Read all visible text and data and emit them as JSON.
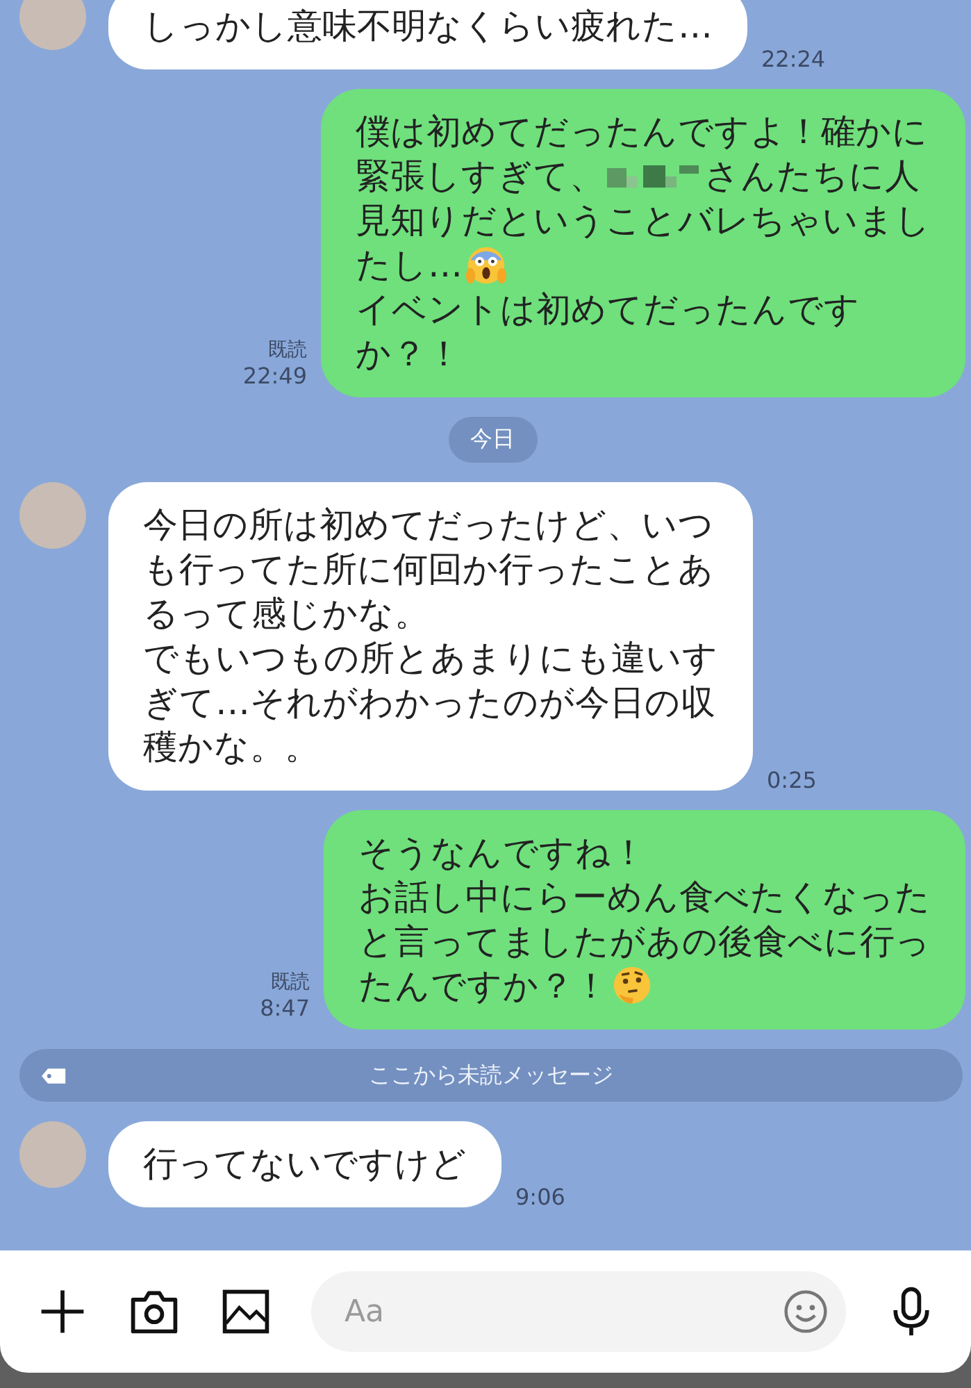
{
  "messages": [
    {
      "kind": "received",
      "lines": [
        [
          {
            "kind": "text",
            "text": "しっかし意味不明なくらい疲れた…"
          }
        ]
      ],
      "time": "22:24"
    },
    {
      "kind": "sent",
      "lines": [
        [
          {
            "kind": "text",
            "text": "僕は初めてだったんですよ！確かに"
          }
        ],
        [
          {
            "kind": "text",
            "text": "緊張しすぎて、"
          },
          {
            "kind": "redacted"
          },
          {
            "kind": "text",
            "text": "さんたちに人"
          }
        ],
        [
          {
            "kind": "text",
            "text": "見知りだということバレちゃいまし"
          }
        ],
        [
          {
            "kind": "text",
            "text": "たし…"
          },
          {
            "kind": "scream"
          }
        ],
        [
          {
            "kind": "text",
            "text": "イベントは初めてだったんです"
          }
        ],
        [
          {
            "kind": "text",
            "text": "か？！"
          }
        ]
      ],
      "read_label": "既読",
      "time": "22:49"
    },
    {
      "kind": "date",
      "text": "今日"
    },
    {
      "kind": "received",
      "lines": [
        [
          {
            "kind": "text",
            "text": "今日の所は初めてだったけど、いつ"
          }
        ],
        [
          {
            "kind": "text",
            "text": "も行ってた所に何回か行ったことあ"
          }
        ],
        [
          {
            "kind": "text",
            "text": "るって感じかな。"
          }
        ],
        [
          {
            "kind": "text",
            "text": "でもいつもの所とあまりにも違いす"
          }
        ],
        [
          {
            "kind": "text",
            "text": "ぎて…それがわかったのが今日の収"
          }
        ],
        [
          {
            "kind": "text",
            "text": "穫かな。。"
          }
        ]
      ],
      "time": "0:25"
    },
    {
      "kind": "sent",
      "lines": [
        [
          {
            "kind": "text",
            "text": "そうなんですね！"
          }
        ],
        [
          {
            "kind": "text",
            "text": "お話し中にらーめん食べたくなった"
          }
        ],
        [
          {
            "kind": "text",
            "text": "と言ってましたがあの後食べに行っ"
          }
        ],
        [
          {
            "kind": "text",
            "text": "たんですか？！"
          },
          {
            "kind": "thinking"
          }
        ]
      ],
      "read_label": "既読",
      "time": "8:47"
    },
    {
      "kind": "unread",
      "text": "ここから未読メッセージ"
    },
    {
      "kind": "received",
      "lines": [
        [
          {
            "kind": "text",
            "text": "行ってないですけど"
          }
        ]
      ],
      "time": "9:06"
    }
  ],
  "input": {
    "placeholder": "Aa"
  }
}
